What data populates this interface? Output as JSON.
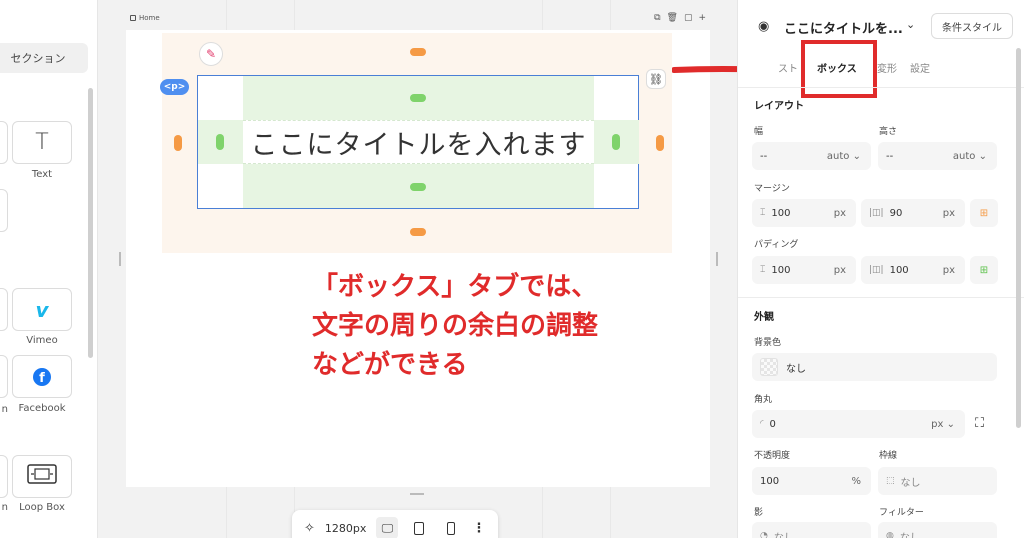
{
  "left_panel": {
    "section_button": "セクション",
    "widgets": [
      {
        "label": "Text",
        "icon": "text-icon"
      },
      {
        "label": "Vimeo",
        "icon": "vimeo-icon"
      },
      {
        "label": "Facebook",
        "icon": "facebook-icon"
      },
      {
        "label": "Loop Box",
        "icon": "loop-box-icon"
      }
    ],
    "partial_labels": [
      "n",
      "n"
    ]
  },
  "canvas": {
    "page_label": "Home",
    "element_tag": "<p>",
    "title_text": "ここにタイトルを入れます"
  },
  "annotation": {
    "lines": [
      "「ボックス」タブでは、",
      "文字の周りの余白の調整",
      "などができる"
    ],
    "color": "#e02b2b"
  },
  "bottom_toolbar": {
    "width_value": "1280px",
    "devices": [
      "desktop-icon",
      "tablet-icon",
      "mobile-icon"
    ],
    "active_device": "desktop-icon"
  },
  "right_panel": {
    "element_title": "ここにタイトルを...",
    "condition_style_button": "条件スタイル",
    "tabs": [
      {
        "label": "スト",
        "active": false
      },
      {
        "label": "ボックス",
        "active": true
      },
      {
        "label": "変形",
        "active": false
      },
      {
        "label": "設定",
        "active": false
      }
    ],
    "layout": {
      "title": "レイアウト",
      "width_label": "幅",
      "width_value": "--",
      "width_unit": "auto",
      "height_label": "高さ",
      "height_value": "--",
      "height_unit": "auto",
      "margin_label": "マージン",
      "margin_vertical": "100",
      "margin_horizontal": "90",
      "padding_label": "パディング",
      "padding_vertical": "100",
      "padding_horizontal": "100",
      "unit_px": "px"
    },
    "appearance": {
      "title": "外観",
      "background_label": "背景色",
      "background_value": "なし",
      "radius_label": "角丸",
      "radius_value": "0",
      "radius_unit": "px",
      "opacity_label": "不透明度",
      "opacity_value": "100",
      "opacity_unit": "%",
      "border_label": "枠線",
      "border_value": "なし",
      "shadow_label": "影",
      "shadow_value": "なし",
      "filter_label": "フィルター",
      "filter_value": "なし"
    }
  },
  "colors": {
    "accent_blue": "#4f8ff0",
    "margin_handle": "#f59a45",
    "padding_handle": "#7fd36b",
    "highlight_red": "#e02b2b"
  }
}
